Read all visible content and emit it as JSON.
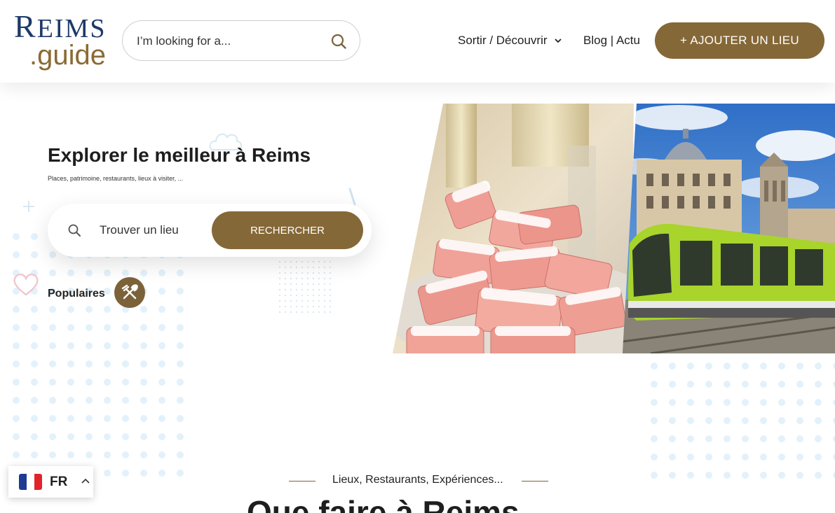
{
  "header": {
    "logo_line1": "Reims",
    "logo_line2": ".guide",
    "search_placeholder": "I’m looking for a...",
    "nav": [
      {
        "label": "Sortir / Découvrir",
        "has_dropdown": true
      },
      {
        "label": "Blog | Actu",
        "has_dropdown": false
      }
    ],
    "add_button": "+ AJOUTER UN LIEU"
  },
  "hero": {
    "title": "Explorer le meilleur à Reims",
    "subtitle": "Places, patrimoine, restaurants, lieux à visiter, ...",
    "search_placeholder": "Trouver un lieu",
    "search_button": "RECHERCHER",
    "popular_label": "Populaires",
    "popular_icon": "utensils-icon",
    "images": [
      "biscuits-roses-photo",
      "tram-reims-photo"
    ]
  },
  "section": {
    "tagline": "Lieux, Restaurants, Expériences...",
    "title": "Que faire à Reims"
  },
  "language": {
    "code": "FR",
    "flag": "france-flag-icon"
  },
  "colors": {
    "brand_gold": "#856838",
    "logo_blue": "#1d3a68",
    "dot_blue": "#e3f1fb"
  }
}
